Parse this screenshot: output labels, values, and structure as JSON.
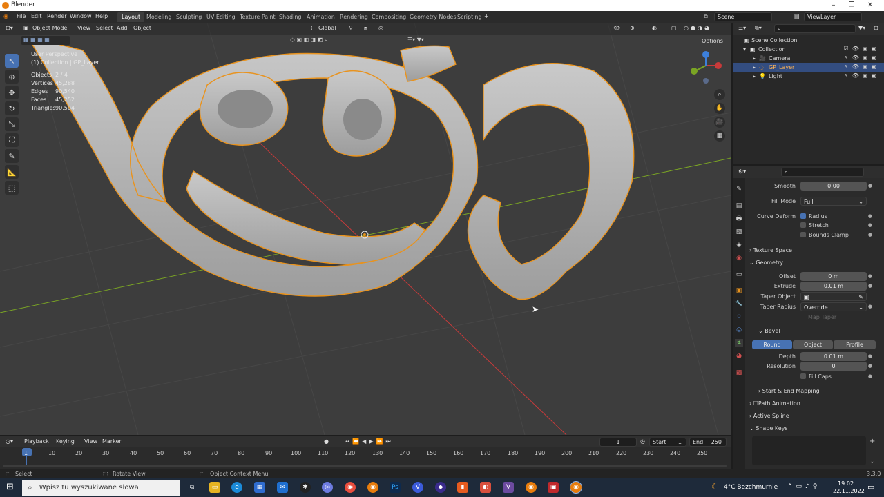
{
  "window": {
    "title": "Blender"
  },
  "menu": [
    "File",
    "Edit",
    "Render",
    "Window",
    "Help"
  ],
  "workspaces": [
    "Layout",
    "Modeling",
    "Sculpting",
    "UV Editing",
    "Texture Paint",
    "Shading",
    "Animation",
    "Rendering",
    "Compositing",
    "Geometry Nodes",
    "Scripting"
  ],
  "active_workspace": "Layout",
  "scene": "Scene",
  "view_layer": "ViewLayer",
  "viewport_header": {
    "mode": "Object Mode",
    "menus": [
      "View",
      "Select",
      "Add",
      "Object"
    ],
    "orientation": "Global",
    "options_label": "Options"
  },
  "viewport_info": {
    "view": "User Perspective",
    "collection": "(1) Collection | GP_Layer",
    "stats": [
      {
        "label": "Objects",
        "value": "2 / 4"
      },
      {
        "label": "Vertices",
        "value": "45,288"
      },
      {
        "label": "Edges",
        "value": "90,540"
      },
      {
        "label": "Faces",
        "value": "45,252"
      },
      {
        "label": "Triangles",
        "value": "90,504"
      }
    ]
  },
  "outliner": {
    "root": "Scene Collection",
    "collection": "Collection",
    "items": [
      "Camera",
      "GP_Layer",
      "Light"
    ]
  },
  "properties": {
    "smooth_label": "Smooth",
    "smooth_value": "0.00",
    "fill_mode_label": "Fill Mode",
    "fill_mode_value": "Full",
    "curve_deform_label": "Curve Deform",
    "radius_label": "Radius",
    "stretch_label": "Stretch",
    "bounds_clamp_label": "Bounds Clamp",
    "texture_space": "Texture Space",
    "geometry": "Geometry",
    "offset_label": "Offset",
    "offset_value": "0 m",
    "extrude_label": "Extrude",
    "extrude_value": "0.01 m",
    "taper_object_label": "Taper Object",
    "taper_radius_label": "Taper Radius",
    "taper_radius_value": "Override",
    "map_taper": "Map Taper",
    "bevel": "Bevel",
    "bevel_modes": [
      "Round",
      "Object",
      "Profile"
    ],
    "depth_label": "Depth",
    "depth_value": "0.01 m",
    "resolution_label": "Resolution",
    "resolution_value": "0",
    "fill_caps_label": "Fill Caps",
    "start_end": "Start & End Mapping",
    "path_animation": "Path Animation",
    "active_spline": "Active Spline",
    "shape_keys": "Shape Keys"
  },
  "timeline": {
    "menus": [
      "Playback",
      "Keying",
      "View",
      "Marker"
    ],
    "current_frame": "1",
    "start_label": "Start",
    "start_value": "1",
    "end_label": "End",
    "end_value": "250",
    "ruler": [
      "1",
      "10",
      "20",
      "30",
      "40",
      "50",
      "60",
      "70",
      "80",
      "90",
      "100",
      "110",
      "120",
      "130",
      "140",
      "150",
      "160",
      "170",
      "180",
      "190",
      "200",
      "210",
      "220",
      "230",
      "240",
      "250"
    ]
  },
  "statusbar": {
    "select": "Select",
    "rotate": "Rotate View",
    "context": "Object Context Menu",
    "version": "3.3.0"
  },
  "taskbar": {
    "search_placeholder": "Wpisz tu wyszukiwane słowa",
    "weather": "4°C  Bezchmurnie",
    "time": "19:02",
    "date": "22.11.2022"
  },
  "colors": {
    "selection_orange": "#e8931f",
    "accent_blue": "#4772b3",
    "x_axis": "#c83a3a",
    "y_axis": "#7aa424"
  }
}
